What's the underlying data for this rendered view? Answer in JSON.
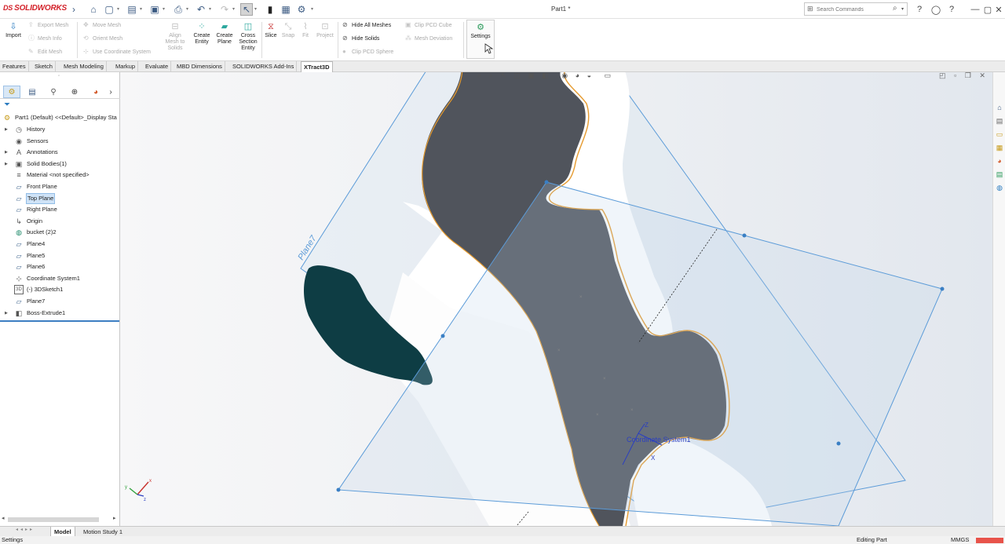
{
  "app": {
    "brand": "SOLIDWORKS",
    "document_title": "Part1 *"
  },
  "quick_access": [
    {
      "name": "home-icon",
      "glyph": "⌂"
    },
    {
      "name": "new-document-icon",
      "glyph": "▢"
    },
    {
      "name": "open-folder-icon",
      "glyph": "▤"
    },
    {
      "name": "save-icon",
      "glyph": "▣"
    },
    {
      "name": "print-icon",
      "glyph": "⎙"
    },
    {
      "name": "undo-icon",
      "glyph": "↶"
    },
    {
      "name": "redo-icon",
      "glyph": "↷"
    },
    {
      "name": "select-arrow-icon",
      "glyph": "↖"
    },
    {
      "name": "rebuild-traffic-light-icon",
      "glyph": "●"
    },
    {
      "name": "file-properties-icon",
      "glyph": "▦"
    },
    {
      "name": "options-gear-icon",
      "glyph": "⚙"
    }
  ],
  "search": {
    "placeholder": "Search Commands"
  },
  "ribbon": {
    "import": "Import",
    "export_mesh": "Export Mesh",
    "mesh_info": "Mesh Info",
    "edit_mesh": "Edit Mesh",
    "move_mesh": "Move Mesh",
    "orient_mesh": "Orient Mesh",
    "use_coordinate_system": "Use Coordinate System",
    "align_mesh": [
      "Align",
      "Mesh to",
      "Solids"
    ],
    "create_entity": [
      "Create",
      "Entity"
    ],
    "create_plane": [
      "Create",
      "Plane"
    ],
    "cross_section": [
      "Cross",
      "Section",
      "Entity"
    ],
    "slice": "Slice",
    "snap": "Snap",
    "fit": "Fit",
    "project": "Project",
    "hide_all_meshes": "Hide All Meshes",
    "hide_solids": "Hide Solids",
    "clip_pcd_sphere": "Clip PCD Sphere",
    "clip_pcd_cube": "Clip PCD Cube",
    "mesh_deviation": "Mesh Deviation",
    "settings": "Settings"
  },
  "tabs": [
    "Features",
    "Sketch",
    "Mesh Modeling",
    "Markup",
    "Evaluate",
    "MBD Dimensions",
    "SOLIDWORKS Add-Ins",
    "XTract3D"
  ],
  "active_tab": "XTract3D",
  "tree": {
    "root": "Part1 (Default) <<Default>_Display Sta",
    "items": [
      {
        "label": "History",
        "icon": "history-icon",
        "glyph": "◷",
        "expandable": true
      },
      {
        "label": "Sensors",
        "icon": "sensors-icon",
        "glyph": "◉",
        "expandable": false
      },
      {
        "label": "Annotations",
        "icon": "annotations-icon",
        "glyph": "A",
        "expandable": true
      },
      {
        "label": "Solid Bodies(1)",
        "icon": "solid-bodies-icon",
        "glyph": "▣",
        "expandable": true
      },
      {
        "label": "Material <not specified>",
        "icon": "material-icon",
        "glyph": "≡",
        "expandable": false
      },
      {
        "label": "Front Plane",
        "icon": "plane-icon",
        "glyph": "▱",
        "expandable": false
      },
      {
        "label": "Top Plane",
        "icon": "plane-icon",
        "glyph": "▱",
        "expandable": false,
        "selected": true
      },
      {
        "label": "Right Plane",
        "icon": "plane-icon",
        "glyph": "▱",
        "expandable": false
      },
      {
        "label": "Origin",
        "icon": "origin-icon",
        "glyph": "↳",
        "expandable": false
      },
      {
        "label": "bucket (2)2",
        "icon": "mesh-body-icon",
        "glyph": "◍",
        "expandable": false
      },
      {
        "label": "Plane4",
        "icon": "plane-icon",
        "glyph": "▱",
        "expandable": false
      },
      {
        "label": "Plane5",
        "icon": "plane-icon",
        "glyph": "▱",
        "expandable": false
      },
      {
        "label": "Plane6",
        "icon": "plane-icon",
        "glyph": "▱",
        "expandable": false
      },
      {
        "label": "Coordinate System1",
        "icon": "coordinate-system-icon",
        "glyph": "⊹",
        "expandable": false
      },
      {
        "label": "(-) 3DSketch1",
        "icon": "3d-sketch-icon",
        "glyph": "3D",
        "expandable": false
      },
      {
        "label": "Plane7",
        "icon": "plane-icon",
        "glyph": "▱",
        "expandable": false
      },
      {
        "label": "Boss-Extrude1",
        "icon": "boss-extrude-icon",
        "glyph": "◧",
        "expandable": true
      }
    ]
  },
  "viewport": {
    "plane_label": "Plane7",
    "coord_label": "Coordinate System1",
    "axis_z": "Z",
    "axis_x": "X",
    "triad_x": "x",
    "triad_y": "y",
    "triad_z": "z",
    "colors": {
      "part": "#50545c",
      "edge": "#e59a2e",
      "plane": "#5b9bd8",
      "mesh": "#0e3d44"
    }
  },
  "bottom_tabs": [
    "Model",
    "Motion Study 1"
  ],
  "active_bottom_tab": "Model",
  "status": {
    "left": "Settings",
    "mode": "Editing Part",
    "units": "MMGS"
  }
}
